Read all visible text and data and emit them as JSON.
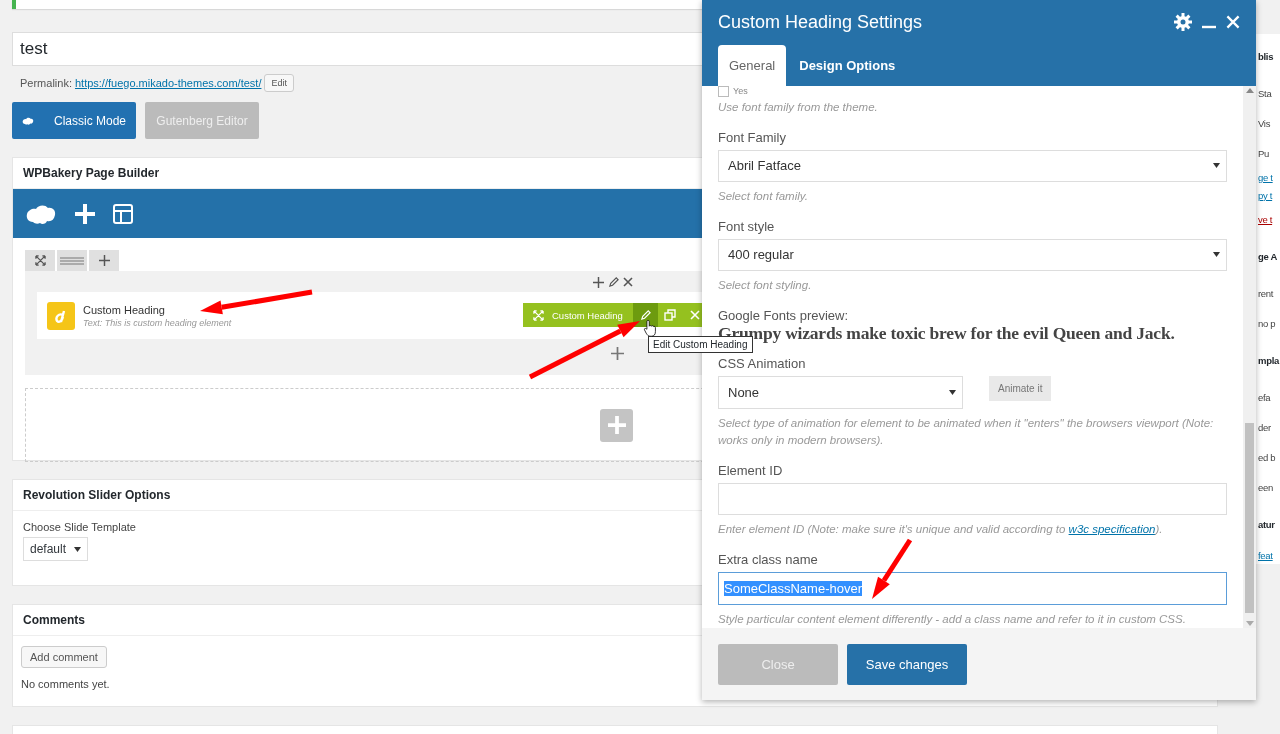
{
  "title_field": {
    "value": "test"
  },
  "permalink": {
    "label": "Permalink:",
    "url": "https://fuego.mikado-themes.com/test/",
    "edit_button": "Edit"
  },
  "editor_modes": [
    {
      "label": "Classic Mode",
      "selected": true
    },
    {
      "label": "Gutenberg Editor",
      "selected": false
    }
  ],
  "page_builder": {
    "title": "WPBakery Page Builder",
    "element": {
      "name": "Custom Heading",
      "description": "Text: This is custom heading element",
      "toolbar_label": "Custom Heading",
      "tooltip": "Edit Custom Heading"
    }
  },
  "slider_options": {
    "title": "Revolution Slider Options",
    "label": "Choose Slide Template",
    "value": "default"
  },
  "comments": {
    "title": "Comments",
    "button": "Add comment",
    "empty": "No comments yet."
  },
  "sidebar_fragments": [
    {
      "kind": "heading",
      "text": "blis"
    },
    {
      "kind": "text",
      "text": "Sta"
    },
    {
      "kind": "text",
      "text": "Vis"
    },
    {
      "kind": "text",
      "text": "Pu"
    },
    {
      "kind": "link",
      "text": "ge t"
    },
    {
      "kind": "link",
      "text": "py t"
    },
    {
      "kind": "danger",
      "text": "ve t"
    },
    {
      "kind": "heading",
      "text": "ge A"
    },
    {
      "kind": "text",
      "text": "rent"
    },
    {
      "kind": "text",
      "text": "no p"
    },
    {
      "kind": "heading",
      "text": "mpla"
    },
    {
      "kind": "text",
      "text": "efa"
    },
    {
      "kind": "text",
      "text": "der"
    },
    {
      "kind": "text",
      "text": "ed b"
    },
    {
      "kind": "text",
      "text": "een"
    },
    {
      "kind": "heading",
      "text": "atur"
    },
    {
      "kind": "link",
      "text": "feat"
    }
  ],
  "modal": {
    "title": "Custom Heading Settings",
    "tabs": [
      {
        "label": "General",
        "selected": true
      },
      {
        "label": "Design Options",
        "selected": false
      }
    ],
    "theme_font": {
      "label": "Yes",
      "checked": false,
      "help": "Use font family from the theme."
    },
    "fields": [
      {
        "kind": "select",
        "label": "Font Family",
        "value": "Abril Fatface",
        "help": "Select font family."
      },
      {
        "kind": "select",
        "label": "Font style",
        "value": "400 regular",
        "help": "Select font styling."
      },
      {
        "kind": "preview",
        "label": "Google Fonts preview:",
        "value": "Grumpy wizards make toxic brew for the evil Queen and Jack."
      },
      {
        "kind": "animation",
        "label": "CSS Animation",
        "value": "None",
        "button": "Animate it",
        "help": "Select type of animation for element to be animated when it \"enters\" the browsers viewport (Note: works only in modern browsers)."
      },
      {
        "kind": "text",
        "label": "Element ID",
        "help": "Enter element ID (Note: make sure it's unique and valid according to ",
        "link": "w3c specification",
        "help_end": ")."
      },
      {
        "kind": "text",
        "label": "Extra class name",
        "value": "SomeClassName-hover",
        "highlighted": true,
        "help": "Style particular content element differently - add a class name and refer to it in custom CSS."
      }
    ],
    "buttons": [
      {
        "kind": "close",
        "label": "Close"
      },
      {
        "kind": "primary",
        "label": "Save changes"
      }
    ]
  }
}
